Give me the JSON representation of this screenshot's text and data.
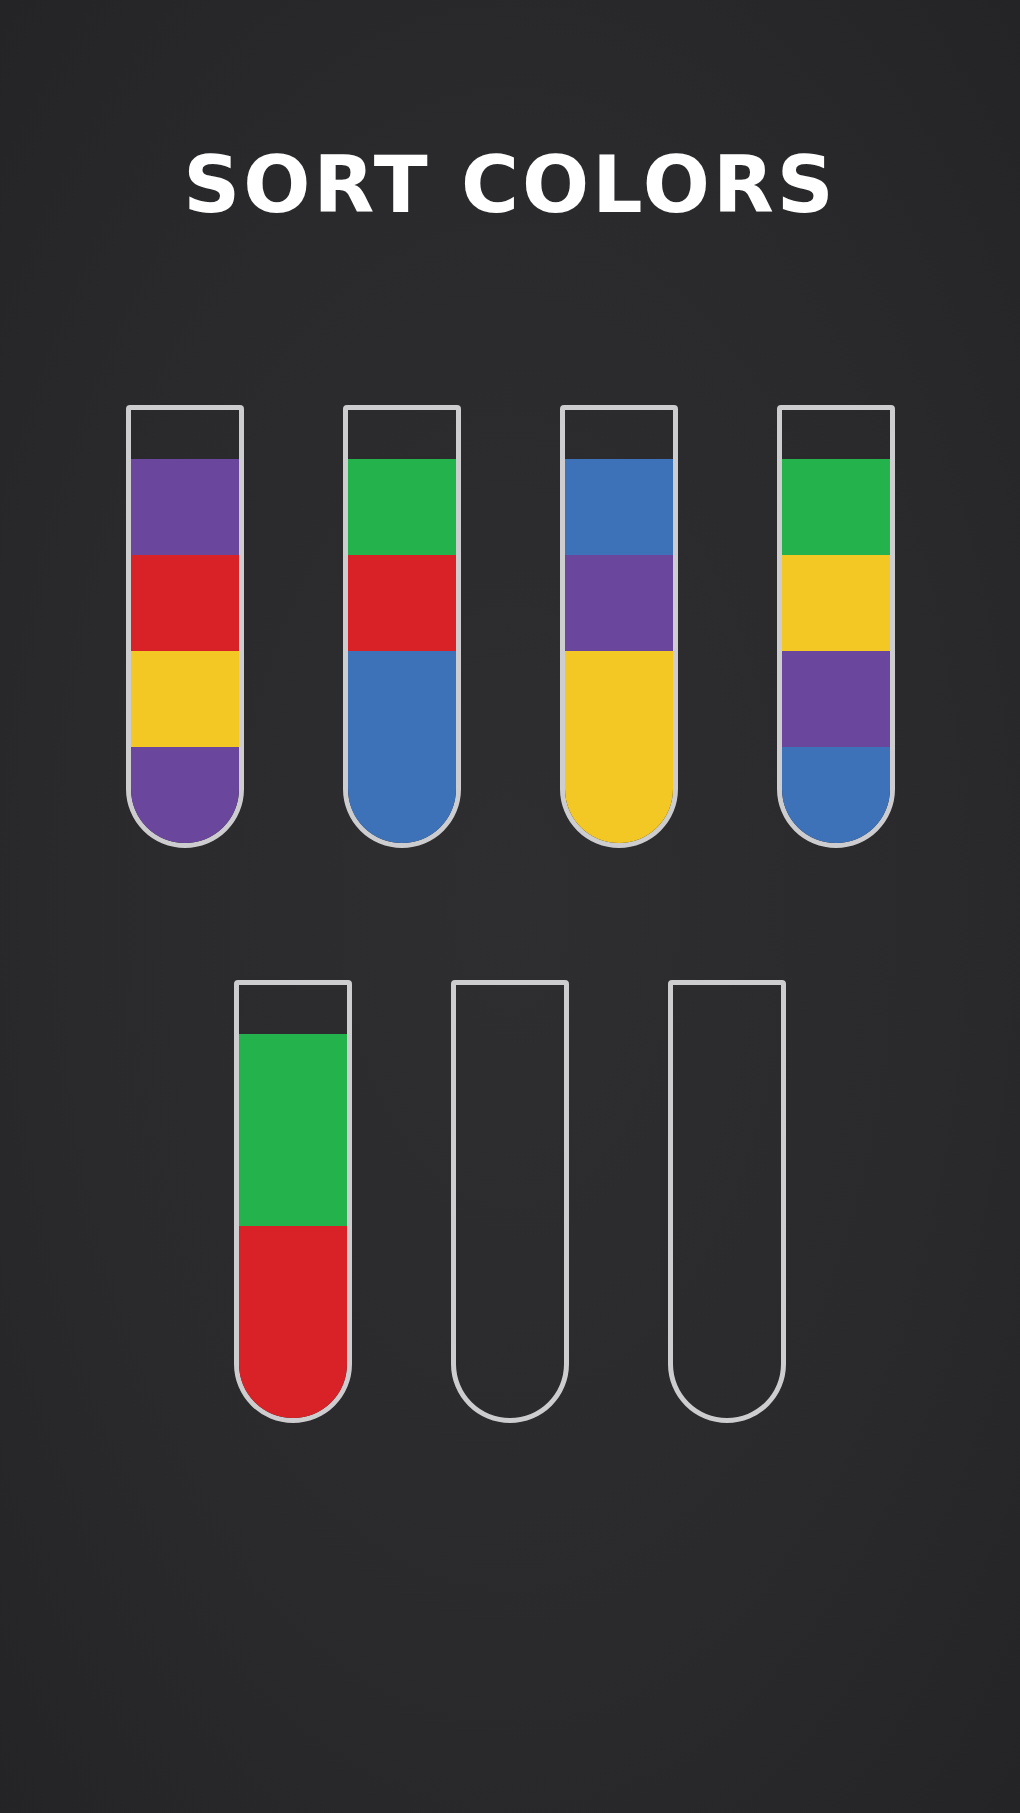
{
  "title": "SORT COLORS",
  "rows": [
    {
      "tubes": [
        {
          "selected": false,
          "segments": [
            {
              "color": "#6a469c"
            },
            {
              "color": "#d92228"
            },
            {
              "color": "#f4c824"
            },
            {
              "color": "#6a469c"
            }
          ]
        },
        {
          "selected": false,
          "segments": [
            {
              "color": "#24b24c"
            },
            {
              "color": "#d92228"
            },
            {
              "color": "#3e72b8"
            },
            {
              "color": "#3e72b8"
            }
          ]
        },
        {
          "selected": false,
          "segments": [
            {
              "color": "#3e72b8"
            },
            {
              "color": "#6a469c"
            },
            {
              "color": "#f4c824"
            },
            {
              "color": "#f4c824"
            }
          ]
        },
        {
          "selected": false,
          "segments": [
            {
              "color": "#24b24c"
            },
            {
              "color": "#f4c824"
            },
            {
              "color": "#6a469c"
            },
            {
              "color": "#3e72b8"
            }
          ]
        }
      ]
    },
    {
      "tubes": [
        {
          "selected": false,
          "segments": [
            {
              "color": "#24b24c"
            },
            {
              "color": "#24b24c"
            },
            {
              "color": "#d92228"
            },
            {
              "color": "#d92228"
            }
          ]
        },
        {
          "selected": false
        },
        {
          "selected": false
        }
      ]
    }
  ]
}
